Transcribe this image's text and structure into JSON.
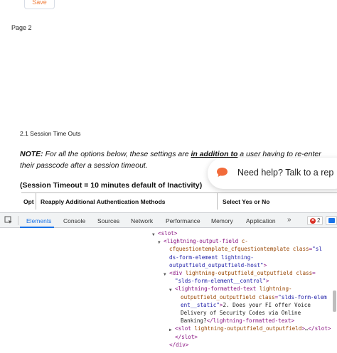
{
  "page": {
    "save_label": "Save",
    "page_label": "Page 2",
    "section_title": "2.1 Session Time Outs",
    "note_label": "NOTE:",
    "note_text_1": "For all the options below, these settings are",
    "note_text_2": "in addition to",
    "note_text_3": "a user having to re-enter their passcode after a session timeout.",
    "timeout_heading": "(Session Timeout = 10 minutes default of Inactivity)",
    "table_headers": [
      "Opt",
      "Reapply Additional Authentication Methods",
      "Select Yes or No"
    ],
    "help_text": "Need help? Talk to a rep",
    "accent_color": "#f08040"
  },
  "devtools": {
    "tabs": [
      "Elements",
      "Console",
      "Sources",
      "Network",
      "Performance",
      "Memory",
      "Application"
    ],
    "active_tab": "Elements",
    "more_label": "»",
    "error_count": "2",
    "accent_color": "#1a73e8",
    "code_lines": [
      {
        "indent": 1,
        "arrow": "▼",
        "parts": [
          [
            "tag",
            "<slot>"
          ]
        ]
      },
      {
        "indent": 2,
        "arrow": "▼",
        "parts": [
          [
            "tag",
            "<lightning-output-field "
          ],
          [
            "an",
            "c-"
          ]
        ]
      },
      {
        "indent": 3,
        "arrow": "",
        "parts": [
          [
            "an",
            "cfquestiontemplate_cfquestiontemplate "
          ],
          [
            "an",
            "class"
          ],
          [
            "tag",
            "="
          ],
          [
            "av",
            "\"sl"
          ]
        ]
      },
      {
        "indent": 3,
        "arrow": "",
        "parts": [
          [
            "av",
            "ds-form-element lightning-"
          ]
        ]
      },
      {
        "indent": 3,
        "arrow": "",
        "parts": [
          [
            "av",
            "outputfield_outputfield-host\""
          ],
          [
            "tag",
            ">"
          ]
        ]
      },
      {
        "indent": 3,
        "arrow": "▼",
        "parts": [
          [
            "tag",
            "<div "
          ],
          [
            "an",
            "lightning-outputfield_outputfield "
          ],
          [
            "an",
            "class"
          ],
          [
            "tag",
            "="
          ]
        ]
      },
      {
        "indent": 4,
        "arrow": "",
        "parts": [
          [
            "av",
            "\"slds-form-element__control\""
          ],
          [
            "tag",
            ">"
          ]
        ]
      },
      {
        "indent": 4,
        "arrow": "▼",
        "parts": [
          [
            "tag",
            "<lightning-formatted-text "
          ],
          [
            "an",
            "lightning-"
          ]
        ]
      },
      {
        "indent": 5,
        "arrow": "",
        "parts": [
          [
            "an",
            "outputfield_outputfield "
          ],
          [
            "an",
            "class"
          ],
          [
            "tag",
            "="
          ],
          [
            "av",
            "\"slds-form-elem"
          ]
        ]
      },
      {
        "indent": 5,
        "arrow": "",
        "parts": [
          [
            "av",
            "ent__static\""
          ],
          [
            "tag",
            ">"
          ],
          [
            "tx",
            "2. Does your FI offer Voice"
          ]
        ]
      },
      {
        "indent": 5,
        "arrow": "",
        "parts": [
          [
            "tx",
            "Delivery of Security Codes via Online"
          ]
        ]
      },
      {
        "indent": 5,
        "arrow": "",
        "parts": [
          [
            "tx",
            "Banking?"
          ],
          [
            "tag",
            "</lightning-formatted-text>"
          ]
        ]
      },
      {
        "indent": 4,
        "arrow": "▶",
        "parts": [
          [
            "tag",
            "<slot "
          ],
          [
            "an",
            "lightning-outputfield_outputfield"
          ],
          [
            "tag",
            ">"
          ],
          [
            "tx",
            "…"
          ],
          [
            "tag",
            "</slot>"
          ]
        ]
      },
      {
        "indent": 4,
        "arrow": "",
        "parts": [
          [
            "tag",
            "</slot>"
          ]
        ]
      },
      {
        "indent": 3,
        "arrow": "",
        "parts": [
          [
            "tag",
            "</div>"
          ]
        ]
      }
    ]
  }
}
